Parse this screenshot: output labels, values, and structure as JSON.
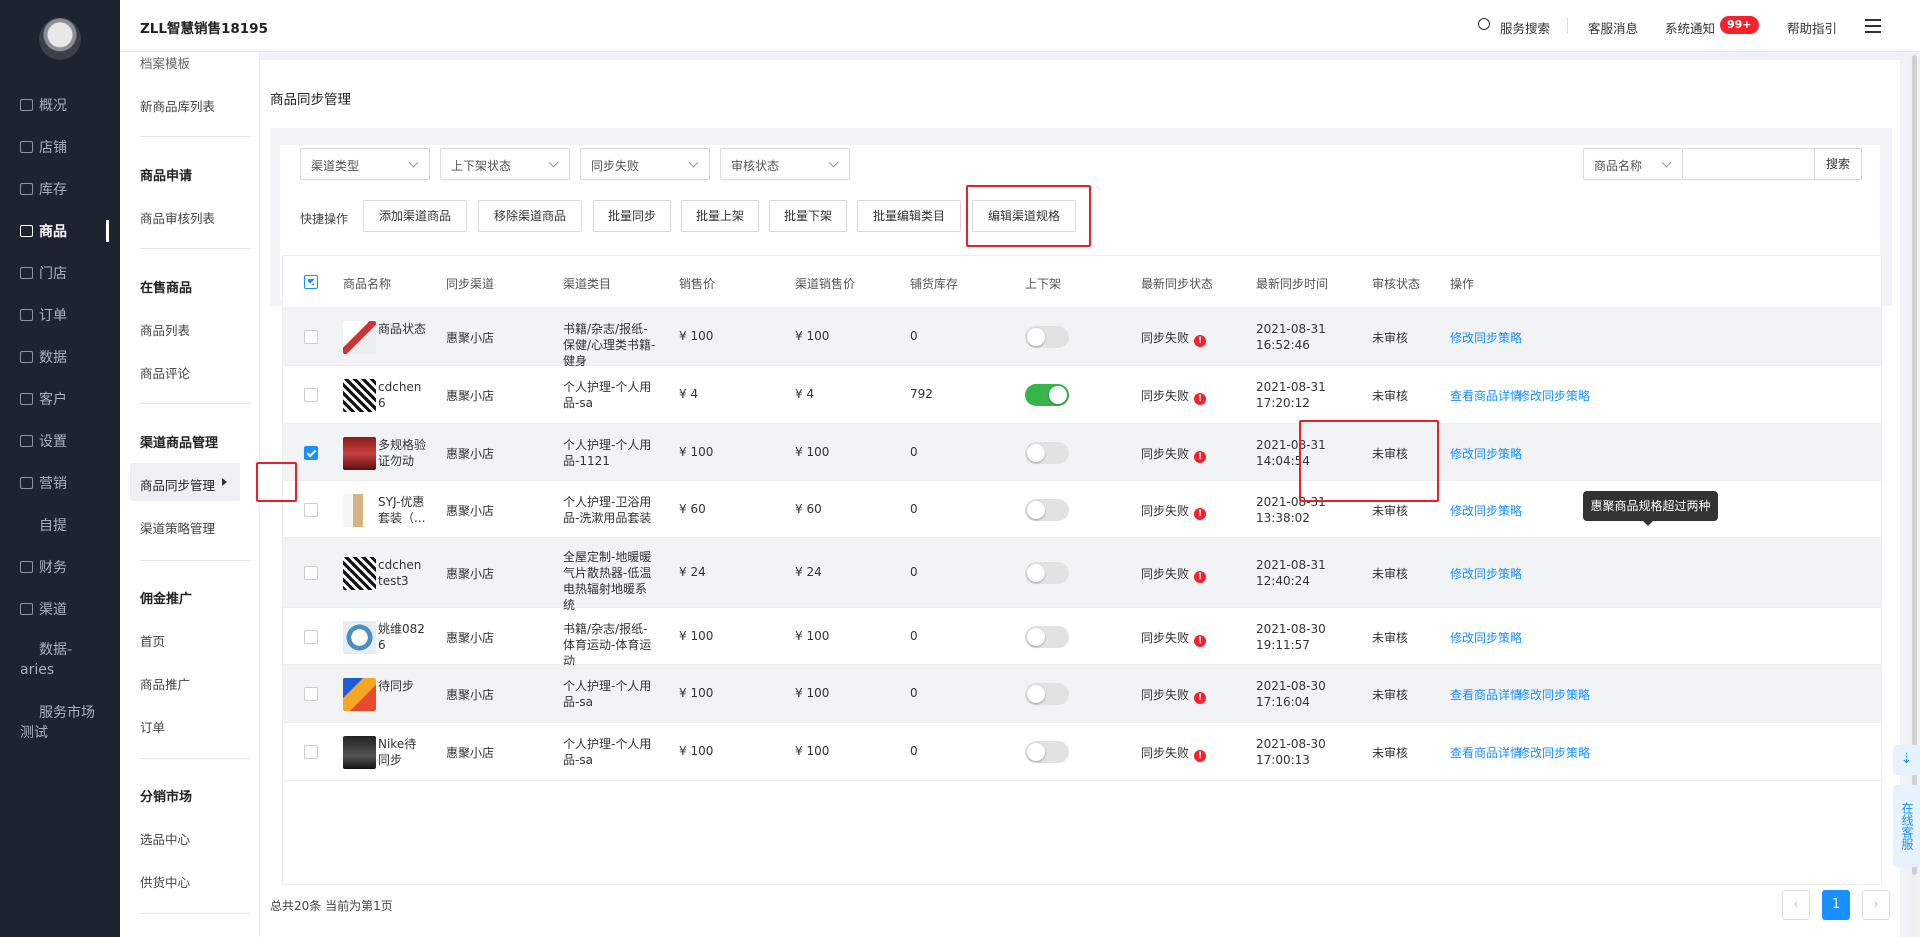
{
  "app": {
    "title": "ZLL智慧销售18195"
  },
  "topbar": {
    "search": "服务搜索",
    "service": "客服消息",
    "notice": "系统通知",
    "notice_badge": "99+",
    "help": "帮助指引"
  },
  "nav": [
    {
      "label": "概况",
      "icon": "dashboard-icon"
    },
    {
      "label": "店铺",
      "icon": "store-icon"
    },
    {
      "label": "库存",
      "icon": "inventory-icon"
    },
    {
      "label": "商品",
      "icon": "goods-icon"
    },
    {
      "label": "门店",
      "icon": "shop-icon"
    },
    {
      "label": "订单",
      "icon": "order-icon"
    },
    {
      "label": "数据",
      "icon": "chart-icon"
    },
    {
      "label": "客户",
      "icon": "customer-icon"
    },
    {
      "label": "设置",
      "icon": "gear-icon"
    },
    {
      "label": "营销",
      "icon": "marketing-icon"
    },
    {
      "label": "自提",
      "icon": ""
    },
    {
      "label": "财务",
      "icon": "finance-icon"
    },
    {
      "label": "渠道",
      "icon": "channel-icon"
    },
    {
      "label": "数据-aries",
      "icon": ""
    },
    {
      "label": "服务市场测试",
      "icon": ""
    }
  ],
  "submenu": {
    "top_item": "档案模板",
    "item_new_lib": "新商品库列表",
    "h_apply": "商品申请",
    "item_audit": "商品审核列表",
    "h_onsale": "在售商品",
    "item_list": "商品列表",
    "item_review": "商品评论",
    "h_channel": "渠道商品管理",
    "item_sync": "商品同步管理",
    "item_strategy": "渠道策略管理",
    "h_commission": "佣金推广",
    "item_home": "首页",
    "item_promo": "商品推广",
    "item_order": "订单",
    "h_market": "分销市场",
    "item_select": "选品中心",
    "item_supply": "供货中心"
  },
  "page": {
    "title": "商品同步管理"
  },
  "filters": {
    "channel_type": "渠道类型",
    "shelf_status": "上下架状态",
    "sync_status": "同步失败",
    "audit_status": "审核状态",
    "search_field": "商品名称",
    "search_btn": "搜索",
    "search_value": ""
  },
  "actions": {
    "label": "快捷操作",
    "add": "添加渠道商品",
    "remove": "移除渠道商品",
    "sync": "批量同步",
    "up": "批量上架",
    "down": "批量下架",
    "edit_cat": "批量编辑类目",
    "edit_spec": "编辑渠道规格"
  },
  "table": {
    "headers": {
      "name": "商品名称",
      "channel": "同步渠道",
      "category": "渠道类目",
      "price": "销售价",
      "channel_price": "渠道销售价",
      "stock": "铺货库存",
      "shelf": "上下架",
      "sync_status": "最新同步状态",
      "sync_time": "最新同步时间",
      "audit": "审核状态",
      "op": "操作"
    },
    "rows": [
      {
        "checked": false,
        "name": "商品状态",
        "channel": "惠聚小店",
        "category": "书籍/杂志/报纸-保健/心理类书籍-健身",
        "price": "¥ 100",
        "channel_price": "¥ 100",
        "stock": "0",
        "on_shelf": false,
        "sync_status": "同步失败",
        "sync_time": "2021-08-31 16:52:46",
        "audit": "未审核",
        "op1": "",
        "op2": "修改同步策略"
      },
      {
        "checked": false,
        "name": "cdchen6",
        "channel": "惠聚小店",
        "category": "个人护理-个人用品-sa",
        "price": "¥ 4",
        "channel_price": "¥ 4",
        "stock": "792",
        "on_shelf": true,
        "sync_status": "同步失败",
        "sync_time": "2021-08-31 17:20:12",
        "audit": "未审核",
        "op1": "查看商品详情",
        "op2": "修改同步策略"
      },
      {
        "checked": true,
        "name": "多规格验证勿动",
        "channel": "惠聚小店",
        "category": "个人护理-个人用品-1121",
        "price": "¥ 100",
        "channel_price": "¥ 100",
        "stock": "0",
        "on_shelf": false,
        "sync_status": "同步失败",
        "sync_time": "2021-08-31 14:04:54",
        "audit": "未审核",
        "op1": "",
        "op2": "修改同步策略"
      },
      {
        "checked": false,
        "name": "SYJ-优惠套装（...",
        "channel": "惠聚小店",
        "category": "个人护理-卫浴用品-洗漱用品套装",
        "price": "¥ 60",
        "channel_price": "¥ 60",
        "stock": "0",
        "on_shelf": false,
        "sync_status": "同步失败",
        "sync_time": "2021-08-31 13:38:02",
        "audit": "未审核",
        "op1": "",
        "op2": "修改同步策略"
      },
      {
        "checked": false,
        "name": "cdchentest3",
        "channel": "惠聚小店",
        "category": "全屋定制-地暖暖气片散热器-低温电热辐射地暖系统",
        "price": "¥ 24",
        "channel_price": "¥ 24",
        "stock": "0",
        "on_shelf": false,
        "sync_status": "同步失败",
        "sync_time": "2021-08-31 12:40:24",
        "audit": "未审核",
        "op1": "",
        "op2": "修改同步策略"
      },
      {
        "checked": false,
        "name": "姚维0826",
        "channel": "惠聚小店",
        "category": "书籍/杂志/报纸-体育运动-体育运动",
        "price": "¥ 100",
        "channel_price": "¥ 100",
        "stock": "0",
        "on_shelf": false,
        "sync_status": "同步失败",
        "sync_time": "2021-08-30 19:11:57",
        "audit": "未审核",
        "op1": "",
        "op2": "修改同步策略"
      },
      {
        "checked": false,
        "name": "待同步",
        "channel": "惠聚小店",
        "category": "个人护理-个人用品-sa",
        "price": "¥ 100",
        "channel_price": "¥ 100",
        "stock": "0",
        "on_shelf": false,
        "sync_status": "同步失败",
        "sync_time": "2021-08-30 17:16:04",
        "audit": "未审核",
        "op1": "查看商品详情",
        "op2": "修改同步策略"
      },
      {
        "checked": false,
        "name": "Nike待同步",
        "channel": "惠聚小店",
        "category": "个人护理-个人用品-sa",
        "price": "¥ 100",
        "channel_price": "¥ 100",
        "stock": "0",
        "on_shelf": false,
        "sync_status": "同步失败",
        "sync_time": "2021-08-30 17:00:13",
        "audit": "未审核",
        "op1": "查看商品详情",
        "op2": "修改同步策略"
      }
    ]
  },
  "tooltip": "惠聚商品规格超过两种",
  "pagination": {
    "summary": "总共20条 当前为第1页",
    "current": "1",
    "prev": "‹",
    "next": "›"
  },
  "float": {
    "download": "⇣",
    "service": "在线客服"
  },
  "colors": {
    "accent": "#1890ff",
    "danger": "#f5222d",
    "toggle_on": "#37b54a",
    "sidebar": "#1e2330"
  }
}
